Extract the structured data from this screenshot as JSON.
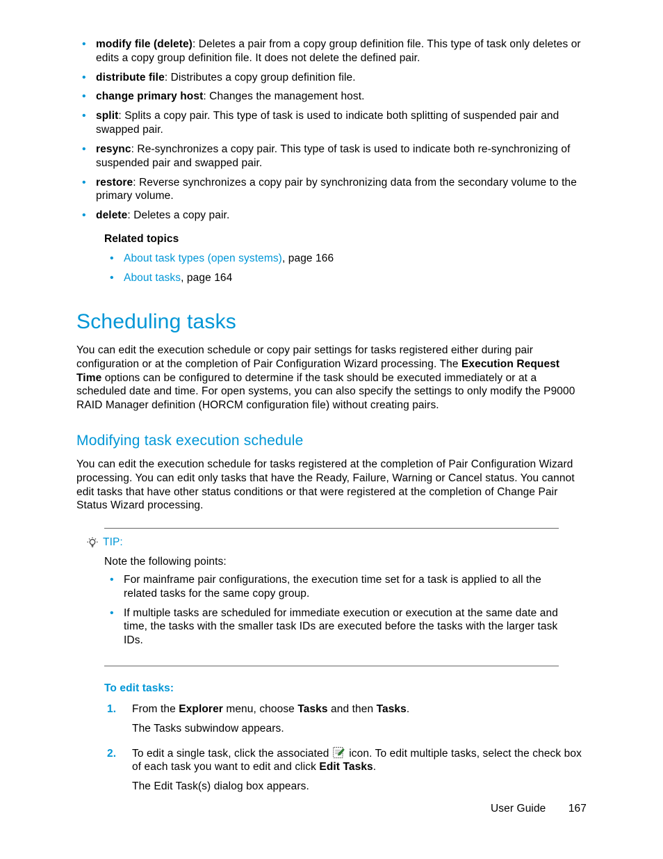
{
  "top_list": [
    {
      "term": "modify file (delete)",
      "desc": ": Deletes a pair from a copy group definition file. This type of task only deletes or edits a copy group definition file. It does not delete the defined pair."
    },
    {
      "term": "distribute file",
      "desc": ": Distributes a copy group definition file."
    },
    {
      "term": "change primary host",
      "desc": ": Changes the management host."
    },
    {
      "term": "split",
      "desc": ": Splits a copy pair. This type of task is used to indicate both splitting of suspended pair and swapped pair."
    },
    {
      "term": "resync",
      "desc": ": Re-synchronizes a copy pair. This type of task is used to indicate both re-synchronizing of suspended pair and swapped pair."
    },
    {
      "term": "restore",
      "desc": ": Reverse synchronizes a copy pair by synchronizing data from the secondary volume to the primary volume."
    },
    {
      "term": "delete",
      "desc": ": Deletes a copy pair."
    }
  ],
  "related": {
    "heading": "Related topics",
    "items": [
      {
        "link": "About task types (open systems)",
        "suffix": ", page 166"
      },
      {
        "link": "About tasks",
        "suffix": ", page 164"
      }
    ]
  },
  "h1": "Scheduling tasks",
  "p1_a": "You can edit the execution schedule or copy pair settings for tasks registered either during pair configuration or at the completion of Pair Configuration Wizard processing. The ",
  "p1_bold1": "Execution Request Time",
  "p1_b": " options can be configured to determine if the task should be executed immediately or at a scheduled date and time. For open systems, you can also specify the settings to only modify the P9000 RAID Manager definition (HORCM configuration file) without creating pairs.",
  "h2": "Modifying task execution schedule",
  "p2": "You can edit the execution schedule for tasks registered at the completion of Pair Configuration Wizard processing. You can edit only tasks that have the Ready, Failure, Warning or Cancel status. You cannot edit tasks that have other status conditions or that were registered at the completion of Change Pair Status Wizard processing.",
  "tip": {
    "label": "TIP:",
    "intro": "Note the following points:",
    "bullets": [
      "For mainframe pair configurations, the execution time set for a task is applied to all the related tasks for the same copy group.",
      "If multiple tasks are scheduled for immediate execution or execution at the same date and time, the tasks with the smaller task IDs are executed before the tasks with the larger task IDs."
    ]
  },
  "steps": {
    "heading": "To edit tasks:",
    "items": [
      {
        "pre": "From the ",
        "b1": "Explorer",
        "mid1": " menu, choose ",
        "b2": "Tasks",
        "mid2": " and then ",
        "b3": "Tasks",
        "post": ".",
        "sub": "The Tasks subwindow appears."
      },
      {
        "pre": "To edit a single task, click the associated ",
        "mid1": " icon. To edit multiple tasks, select the check box of each task you want to edit and click ",
        "b1": "Edit Tasks",
        "post": ".",
        "sub": "The Edit Task(s) dialog box appears."
      }
    ]
  },
  "footer": {
    "title": "User Guide",
    "page": "167"
  }
}
